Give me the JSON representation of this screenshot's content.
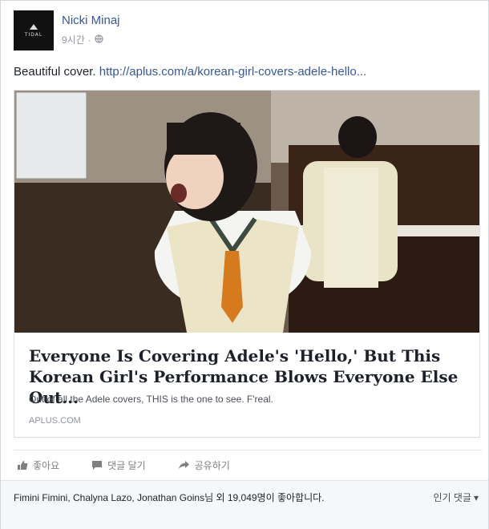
{
  "post": {
    "author": "Nicki Minaj",
    "avatar_label": "TIDAL",
    "time": "9시간",
    "separator": "·",
    "text": "Beautiful cover.",
    "link_text": "http://aplus.com/a/korean-girl-covers-adele-hello..."
  },
  "link_card": {
    "title": "Everyone Is Covering Adele's 'Hello,' But This Korean Girl's Performance Blows Everyone Else Out...",
    "description": "Out of all the Adele covers, THIS is the one to see. F'real.",
    "domain": "APLUS.COM"
  },
  "actions": {
    "like": "좋아요",
    "comment": "댓글 달기",
    "share": "공유하기"
  },
  "likes": {
    "names": "Fimini Fimini, Chalyna Lazo, Jonathan Goins",
    "suffix": "님 외 19,049명이 좋아합니다.",
    "comments_sort": "인기 댓글",
    "sort_arrow": "▾"
  },
  "colors": {
    "link_blue": "#365899",
    "muted": "#90949c"
  }
}
